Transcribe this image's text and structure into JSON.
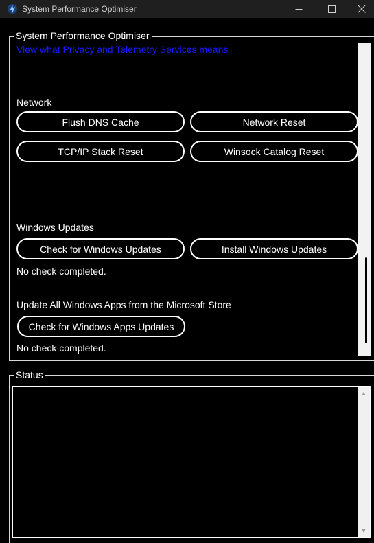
{
  "window": {
    "title": "System Performance Optimiser",
    "controls": {
      "minimize": "—",
      "maximize": "☐",
      "close": "✕"
    }
  },
  "optimiser": {
    "group_title": "System Performance Optimiser",
    "privacy_link": "View what Privacy and Telemetry Services means",
    "network": {
      "label": "Network",
      "buttons": [
        "Flush DNS Cache",
        "Network Reset",
        "TCP/IP Stack Reset",
        "Winsock Catalog Reset"
      ]
    },
    "windows_updates": {
      "label": "Windows Updates",
      "buttons": [
        "Check for Windows Updates",
        "Install Windows Updates"
      ],
      "status": "No check completed."
    },
    "store_apps": {
      "label": "Update All Windows Apps from the Microsoft Store",
      "button": "Check for Windows Apps Updates",
      "status": "No check completed."
    }
  },
  "status_panel": {
    "group_title": "Status",
    "text": "",
    "scroll_up": "▲",
    "scroll_down": "▼"
  },
  "colors": {
    "background": "#000000",
    "titlebar": "#1f1f1f",
    "link": "#1a1aff",
    "border": "#ffffff"
  }
}
